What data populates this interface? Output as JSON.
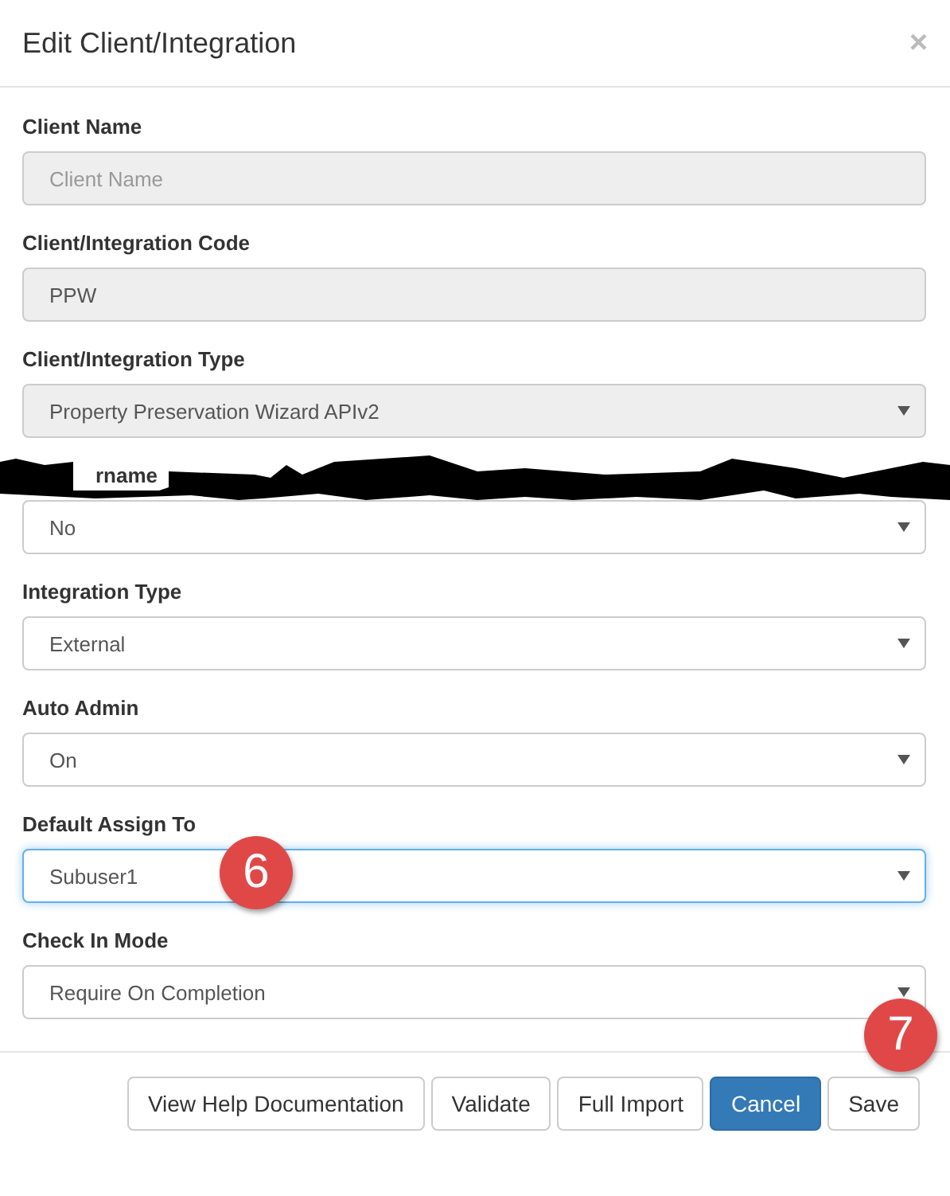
{
  "dialog": {
    "title": "Edit Client/Integration",
    "close": "×"
  },
  "fields": [
    {
      "label": "Client Name",
      "kind": "input",
      "disabled": true,
      "placeholder": "Client Name",
      "focused": false,
      "redacted": false
    },
    {
      "label": "Client/Integration Code",
      "kind": "input",
      "disabled": true,
      "value": "PPW",
      "focused": false,
      "redacted": false
    },
    {
      "label": "Client/Integration Type",
      "kind": "select",
      "disabled": true,
      "value": "Property Preservation Wizard APIv2",
      "focused": false,
      "redacted": false
    },
    {
      "label": "rname",
      "kind": "select",
      "disabled": false,
      "value": "No",
      "focused": false,
      "redacted": true
    },
    {
      "label": "Integration Type",
      "kind": "select",
      "disabled": false,
      "value": "External",
      "focused": false,
      "redacted": false
    },
    {
      "label": "Auto Admin",
      "kind": "select",
      "disabled": false,
      "value": "On",
      "focused": false,
      "redacted": false
    },
    {
      "label": "Default Assign To",
      "kind": "select",
      "disabled": false,
      "value": "Subuser1",
      "focused": true,
      "redacted": false,
      "badge": "6"
    },
    {
      "label": "Check In Mode",
      "kind": "select",
      "disabled": false,
      "value": "Require On Completion",
      "focused": false,
      "redacted": false
    }
  ],
  "buttons": [
    {
      "label": "View Help Documentation",
      "kind": "default"
    },
    {
      "label": "Validate",
      "kind": "default"
    },
    {
      "label": "Full Import",
      "kind": "default"
    },
    {
      "label": "Cancel",
      "kind": "primary"
    },
    {
      "label": "Save",
      "kind": "default",
      "badge": "7"
    }
  ]
}
